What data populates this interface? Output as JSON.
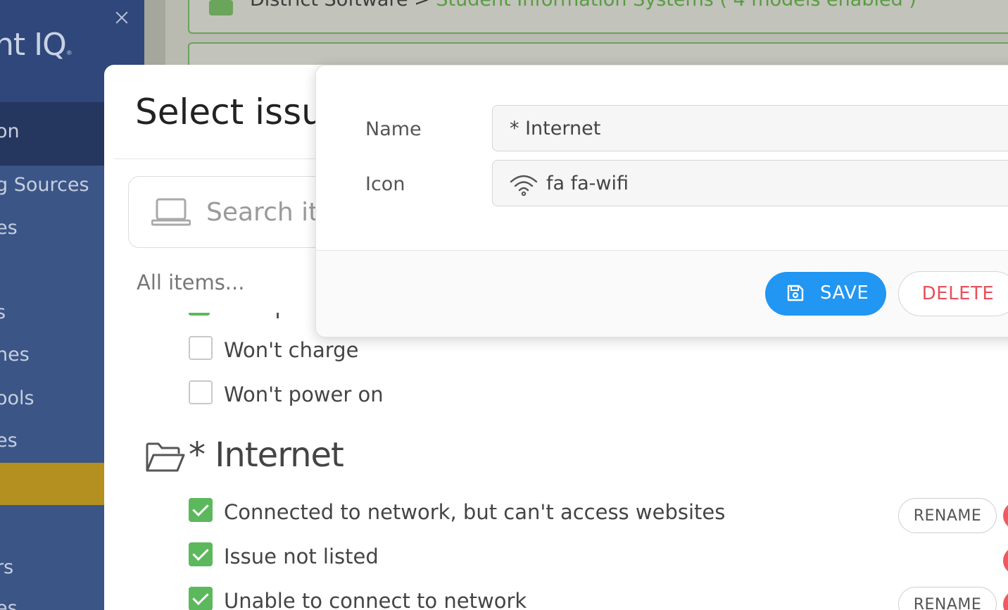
{
  "sidebar": {
    "logo": "nt IQ",
    "logo_mark": "®",
    "items": [
      "on",
      "g Sources",
      "es",
      "s",
      "nes",
      "ools",
      "es",
      "rs",
      "es"
    ]
  },
  "background": {
    "card1_prefix": "District Software > ",
    "card1_link": "Student Information Systems",
    "card1_suffix": " ( 4 models enabled )"
  },
  "modal": {
    "title": "Select issue",
    "search_placeholder": "Search items",
    "all_items_label": "All items...",
    "items_before_group": [
      {
        "label": "Won't charge",
        "checked": false
      },
      {
        "label": "Won't power on",
        "checked": false
      }
    ],
    "group": {
      "name": "* Internet",
      "items": [
        {
          "label": "Connected to network, but can't access websites",
          "checked": true,
          "action": "RENAME"
        },
        {
          "label": "Issue not listed",
          "checked": true,
          "action": ""
        },
        {
          "label": "Unable to connect to network",
          "checked": true,
          "action": "RENAME"
        }
      ]
    }
  },
  "popup": {
    "name_label": "Name",
    "name_value": "* Internet",
    "icon_label": "Icon",
    "icon_value": "fa fa-wifi",
    "save_label": "SAVE",
    "delete_label": "DELETE"
  },
  "colors": {
    "sidebar": "#3b5586",
    "highlight": "#b3901f",
    "checkbox_checked": "#5cb85c",
    "save": "#2196f3",
    "delete_text": "#e8505b"
  },
  "icons": [
    "close-icon",
    "laptop-icon",
    "folder-open-icon",
    "wifi-icon",
    "floppy-disk-icon",
    "checkmark-icon"
  ]
}
